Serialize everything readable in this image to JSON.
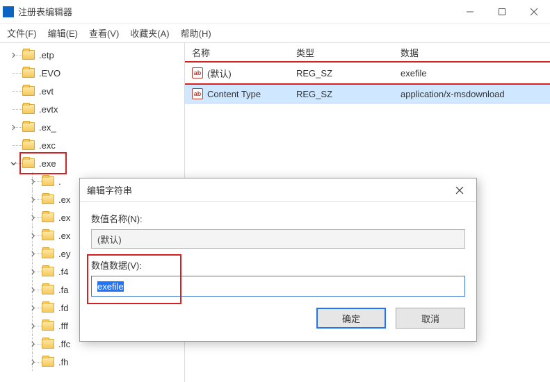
{
  "window": {
    "title": "注册表编辑器"
  },
  "menu": {
    "file": "文件(F)",
    "edit": "编辑(E)",
    "view": "查看(V)",
    "favorites": "收藏夹(A)",
    "help": "帮助(H)"
  },
  "tree": {
    "items": [
      {
        "label": ".etp",
        "expandable": true
      },
      {
        "label": ".EVO",
        "expandable": false
      },
      {
        "label": ".evt",
        "expandable": false
      },
      {
        "label": ".evtx",
        "expandable": false
      },
      {
        "label": ".ex_",
        "expandable": true
      },
      {
        "label": ".exc",
        "expandable": false
      },
      {
        "label": ".exe",
        "expandable": true,
        "open": true,
        "highlighted": true
      }
    ],
    "children": [
      {
        "label": "."
      },
      {
        "label": ".ex"
      },
      {
        "label": ".ex"
      },
      {
        "label": ".ex"
      },
      {
        "label": ".ey"
      },
      {
        "label": ".f4"
      },
      {
        "label": ".fa"
      },
      {
        "label": ".fd"
      },
      {
        "label": ".fff"
      },
      {
        "label": ".ffc"
      },
      {
        "label": ".fh"
      }
    ]
  },
  "list": {
    "headers": {
      "name": "名称",
      "type": "类型",
      "data": "数据"
    },
    "rows": [
      {
        "name": "(默认)",
        "type": "REG_SZ",
        "data": "exefile",
        "selected": false,
        "highlighted": true
      },
      {
        "name": "Content Type",
        "type": "REG_SZ",
        "data": "application/x-msdownload",
        "selected": true
      }
    ]
  },
  "dialog": {
    "title": "编辑字符串",
    "name_label": "数值名称(N):",
    "name_value": "(默认)",
    "data_label": "数值数据(V):",
    "data_value": "exefile",
    "ok": "确定",
    "cancel": "取消"
  }
}
